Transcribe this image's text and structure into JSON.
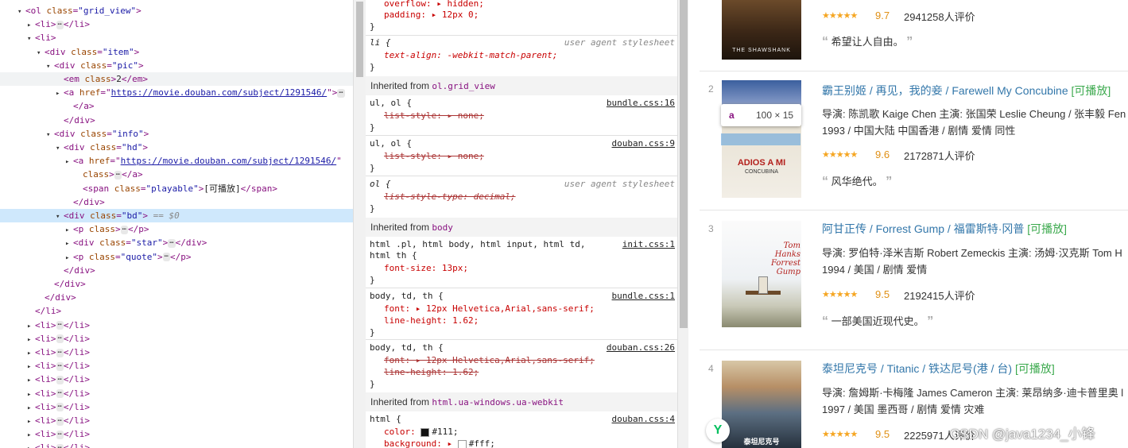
{
  "dom_tree": [
    {
      "tri": "▾",
      "parts": [
        [
          "tag",
          "<ol "
        ],
        [
          "attr",
          "class"
        ],
        [
          "tag",
          "="
        ],
        [
          "val",
          "\"grid_view\""
        ],
        [
          "tag",
          ">"
        ]
      ]
    },
    {
      "tri": "▸",
      "parts": [
        [
          "tag",
          "<li>"
        ],
        [
          "ell",
          "⋯"
        ],
        [
          "tag",
          "</li>"
        ]
      ]
    },
    {
      "tri": "▾",
      "parts": [
        [
          "tag",
          "<li>"
        ]
      ]
    },
    {
      "tri": "▾",
      "parts": [
        [
          "tag",
          "<div "
        ],
        [
          "attr",
          "class"
        ],
        [
          "tag",
          "="
        ],
        [
          "val",
          "\"item\""
        ],
        [
          "tag",
          ">"
        ]
      ]
    },
    {
      "tri": "▾",
      "parts": [
        [
          "tag",
          "<div "
        ],
        [
          "attr",
          "class"
        ],
        [
          "tag",
          "="
        ],
        [
          "val",
          "\"pic\""
        ],
        [
          "tag",
          ">"
        ]
      ]
    },
    {
      "tri": "",
      "parts": [
        [
          "tag",
          "<em "
        ],
        [
          "attr",
          "class"
        ],
        [
          "tag",
          ">"
        ],
        [
          "txt",
          "2"
        ],
        [
          "tag",
          "</em>"
        ]
      ]
    },
    {
      "tri": "▸",
      "parts": [
        [
          "tag",
          "<a "
        ],
        [
          "attr",
          "href"
        ],
        [
          "tag",
          "=\""
        ],
        [
          "lnk",
          "https://movie.douban.com/subject/1291546/"
        ],
        [
          "tag",
          "\">"
        ],
        [
          "ell",
          "⋯"
        ]
      ]
    },
    {
      "tri": "",
      "parts": [
        [
          "tag",
          "</a>"
        ]
      ]
    },
    {
      "tri": "",
      "parts": [
        [
          "tag",
          "</div>"
        ]
      ]
    },
    {
      "tri": "▾",
      "parts": [
        [
          "tag",
          "<div "
        ],
        [
          "attr",
          "class"
        ],
        [
          "tag",
          "="
        ],
        [
          "val",
          "\"info\""
        ],
        [
          "tag",
          ">"
        ]
      ]
    },
    {
      "tri": "▾",
      "parts": [
        [
          "tag",
          "<div "
        ],
        [
          "attr",
          "class"
        ],
        [
          "tag",
          "="
        ],
        [
          "val",
          "\"hd\""
        ],
        [
          "tag",
          ">"
        ]
      ]
    },
    {
      "tri": "▸",
      "parts": [
        [
          "tag",
          "<a "
        ],
        [
          "attr",
          "href"
        ],
        [
          "tag",
          "=\""
        ],
        [
          "lnk",
          "https://movie.douban.com/subject/1291546/"
        ],
        [
          "tag",
          "\""
        ]
      ]
    },
    {
      "tri": "",
      "parts": [
        [
          "attr",
          "class"
        ],
        [
          "tag",
          ">"
        ],
        [
          "ell",
          "⋯"
        ],
        [
          "tag",
          "</a>"
        ]
      ]
    },
    {
      "tri": "",
      "parts": [
        [
          "tag",
          "<span "
        ],
        [
          "attr",
          "class"
        ],
        [
          "tag",
          "="
        ],
        [
          "val",
          "\"playable\""
        ],
        [
          "tag",
          ">"
        ],
        [
          "txt",
          "[可播放]"
        ],
        [
          "tag",
          "</span>"
        ]
      ]
    },
    {
      "tri": "",
      "parts": [
        [
          "tag",
          "</div>"
        ]
      ]
    },
    {
      "tri": "▾",
      "parts": [
        [
          "tag",
          "<div "
        ],
        [
          "attr",
          "class"
        ],
        [
          "tag",
          "="
        ],
        [
          "val",
          "\"bd\""
        ],
        [
          "tag",
          ">"
        ],
        [
          "cmt",
          " == $0"
        ]
      ]
    },
    {
      "tri": "▸",
      "parts": [
        [
          "tag",
          "<p "
        ],
        [
          "attr",
          "class"
        ],
        [
          "tag",
          ">"
        ],
        [
          "ell",
          "⋯"
        ],
        [
          "tag",
          "</p>"
        ]
      ]
    },
    {
      "tri": "▸",
      "parts": [
        [
          "tag",
          "<div "
        ],
        [
          "attr",
          "class"
        ],
        [
          "tag",
          "="
        ],
        [
          "val",
          "\"star\""
        ],
        [
          "tag",
          ">"
        ],
        [
          "ell",
          "⋯"
        ],
        [
          "tag",
          "</div>"
        ]
      ]
    },
    {
      "tri": "▸",
      "parts": [
        [
          "tag",
          "<p "
        ],
        [
          "attr",
          "class"
        ],
        [
          "tag",
          "="
        ],
        [
          "val",
          "\"quote\""
        ],
        [
          "tag",
          ">"
        ],
        [
          "ell",
          "⋯"
        ],
        [
          "tag",
          "</p>"
        ]
      ]
    },
    {
      "tri": "",
      "parts": [
        [
          "tag",
          "</div>"
        ]
      ]
    },
    {
      "tri": "",
      "parts": [
        [
          "tag",
          "</div>"
        ]
      ]
    },
    {
      "tri": "",
      "parts": [
        [
          "tag",
          "</div>"
        ]
      ]
    },
    {
      "tri": "",
      "parts": [
        [
          "tag",
          "</li>"
        ]
      ]
    },
    {
      "tri": "▸",
      "parts": [
        [
          "tag",
          "<li>"
        ],
        [
          "ell",
          "⋯"
        ],
        [
          "tag",
          "</li>"
        ]
      ]
    },
    {
      "tri": "▸",
      "parts": [
        [
          "tag",
          "<li>"
        ],
        [
          "ell",
          "⋯"
        ],
        [
          "tag",
          "</li>"
        ]
      ]
    },
    {
      "tri": "▸",
      "parts": [
        [
          "tag",
          "<li>"
        ],
        [
          "ell",
          "⋯"
        ],
        [
          "tag",
          "</li>"
        ]
      ]
    },
    {
      "tri": "▸",
      "parts": [
        [
          "tag",
          "<li>"
        ],
        [
          "ell",
          "⋯"
        ],
        [
          "tag",
          "</li>"
        ]
      ]
    },
    {
      "tri": "▸",
      "parts": [
        [
          "tag",
          "<li>"
        ],
        [
          "ell",
          "⋯"
        ],
        [
          "tag",
          "</li>"
        ]
      ]
    },
    {
      "tri": "▸",
      "parts": [
        [
          "tag",
          "<li>"
        ],
        [
          "ell",
          "⋯"
        ],
        [
          "tag",
          "</li>"
        ]
      ]
    },
    {
      "tri": "▸",
      "parts": [
        [
          "tag",
          "<li>"
        ],
        [
          "ell",
          "⋯"
        ],
        [
          "tag",
          "</li>"
        ]
      ]
    },
    {
      "tri": "▸",
      "parts": [
        [
          "tag",
          "<li>"
        ],
        [
          "ell",
          "⋯"
        ],
        [
          "tag",
          "</li>"
        ]
      ]
    },
    {
      "tri": "▸",
      "parts": [
        [
          "tag",
          "<li>"
        ],
        [
          "ell",
          "⋯"
        ],
        [
          "tag",
          "</li>"
        ]
      ]
    },
    {
      "tri": "▸",
      "parts": [
        [
          "tag",
          "<li>"
        ],
        [
          "ell",
          "⋯"
        ],
        [
          "tag",
          "</li>"
        ]
      ]
    }
  ],
  "styles": {
    "overflow_line": "overflow: ▸ hidden;",
    "padding_line": "padding: ▸ 12px 0;",
    "close": "}",
    "li_selector": "li {",
    "li_text_align": "text-align: -webkit-match-parent;",
    "user_agent": "user agent stylesheet",
    "inherited_label": "Inherited from",
    "inherited_ol": "ol.grid_view",
    "ulol_selector": "ul, ol {",
    "bundle16": "bundle.css:16",
    "douban9": "douban.css:9",
    "list_style": "list-style: ▸ none;",
    "ol_selector": "ol {",
    "list_style_type": "list-style-type: decimal;",
    "inherited_body": "body",
    "html_pl_selector_1": "html .pl, html body, html input, html td,",
    "html_pl_selector_2": "html th {",
    "init1": "init.css:1",
    "font_size": "font-size: 13px;",
    "body_td_th": "body, td, th {",
    "bundle1": "bundle.css:1",
    "font_line": "font: ▸ 12px Helvetica,Arial,sans-serif;",
    "line_height": "line-height: 1.62;",
    "douban26": "douban.css:26",
    "inherited_html": "html.ua-windows.ua-webkit",
    "html_selector": "html {",
    "douban4": "douban.css:4",
    "color_line": "color: ",
    "color_value": "#111;",
    "background_line": "background: ▸ ",
    "background_value": "#fff;",
    "color_swatch": "#111111",
    "bg_swatch": "#ffffff"
  },
  "page": {
    "item1": {
      "rating_stars": "★★★★★",
      "score": "9.7",
      "votes": "2941258人评价",
      "quote": "希望让人自由。"
    },
    "item2": {
      "rank": "2",
      "title": "霸王别姬",
      "other": "/ 再见，我的妾 / Farewell My Concubine",
      "playable": "[可播放]",
      "bd1": "导演: 陈凯歌 Kaige Chen   主演: 张国荣 Leslie Cheung / 张丰毅 Fen",
      "bd2": "1993 / 中国大陆 中国香港 / 剧情 爱情 同性",
      "rating_stars": "★★★★★",
      "score": "9.6",
      "votes": "2172871人评价",
      "quote": "风华绝代。"
    },
    "item3": {
      "rank": "3",
      "title": "阿甘正传",
      "other": "/ Forrest Gump  / 福雷斯特·冈普",
      "playable": "[可播放]",
      "bd1": "导演: 罗伯特·泽米吉斯 Robert Zemeckis   主演: 汤姆·汉克斯 Tom H",
      "bd2": "1994 / 美国 / 剧情 爱情",
      "rating_stars": "★★★★★",
      "score": "9.5",
      "votes": "2192415人评价",
      "quote": "一部美国近现代史。",
      "poster_lines": [
        "Tom",
        "Hanks",
        "Forrest",
        "Gump"
      ]
    },
    "item4": {
      "rank": "4",
      "title": "泰坦尼克号",
      "other": "/ Titanic  / 铁达尼号(港 / 台)",
      "playable": "[可播放]",
      "bd1": "导演: 詹姆斯·卡梅隆 James Cameron   主演: 莱昂纳多·迪卡普里奥 l",
      "bd2": "1997 / 美国 墨西哥 / 剧情 爱情 灾难",
      "rating_stars": "★★★★★",
      "score": "9.5",
      "votes": "2225971人评价",
      "poster_text": "泰坦尼克号"
    },
    "poster1_text": "THE SHAWSHANK",
    "poster2_title": "ADIOS A MI",
    "poster2_sub": "CONCUBINA"
  },
  "tooltip": {
    "tag": "a",
    "size": "100 × 15"
  },
  "watermark": "CSDN @java1234_小锋",
  "wx_icon": "wechat-icon"
}
